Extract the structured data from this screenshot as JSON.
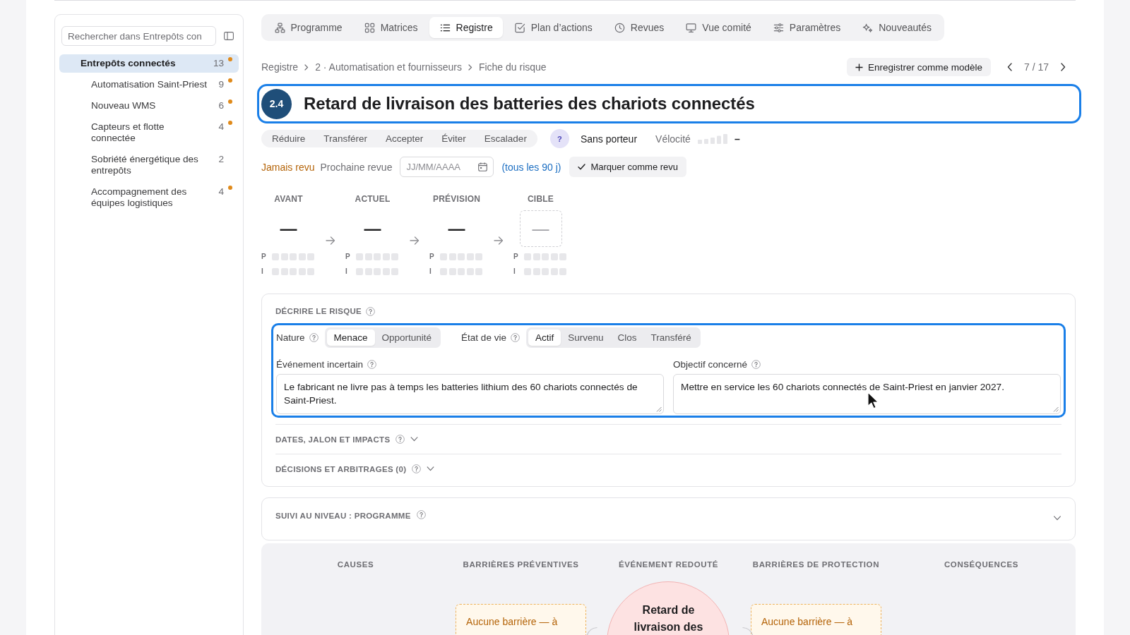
{
  "sidebar": {
    "search": {
      "placeholder": "Rechercher dans Entrepôts con"
    },
    "items": [
      {
        "label": "Entrepôts connectés",
        "count": "13",
        "flagged": true,
        "selected": true,
        "children": [
          {
            "label": "Automatisation Saint-Priest",
            "count": "9",
            "flagged": true,
            "selected": false
          },
          {
            "label": "Nouveau WMS",
            "count": "6",
            "flagged": true,
            "selected": false
          },
          {
            "label": "Capteurs et flotte connectée",
            "count": "4",
            "flagged": true,
            "selected": false
          },
          {
            "label": "Sobriété énergétique des entrepôts",
            "count": "2",
            "flagged": false,
            "selected": false
          },
          {
            "label": "Accompagnement des équipes logistiques",
            "count": "4",
            "flagged": true,
            "selected": false
          }
        ]
      }
    ]
  },
  "tabs": [
    {
      "label": "Programme",
      "selected": false
    },
    {
      "label": "Matrices",
      "selected": false
    },
    {
      "label": "Registre",
      "selected": true
    },
    {
      "label": "Plan d’actions",
      "selected": false
    },
    {
      "label": "Revues",
      "selected": false
    },
    {
      "label": "Vue comité",
      "selected": false
    },
    {
      "label": "Paramètres",
      "selected": false
    },
    {
      "label": "Nouveautés",
      "selected": false
    }
  ],
  "breadcrumb": [
    "Registre",
    "2 · Automatisation et fournisseurs",
    "Fiche du risque"
  ],
  "save_template_button": "Enregistrer comme modèle",
  "pager": "7 / 17",
  "risk": {
    "number": "2.4",
    "title": "Retard de livraison des batteries des chariots connectés",
    "focused": true
  },
  "responses": [
    {
      "label": "Réduire",
      "selected": false
    },
    {
      "label": "Transférer",
      "selected": false
    },
    {
      "label": "Accepter",
      "selected": false
    },
    {
      "label": "Éviter",
      "selected": false
    },
    {
      "label": "Escalader",
      "selected": false
    }
  ],
  "owner": {
    "avatar": "?",
    "name": "Sans porteur"
  },
  "velocity": {
    "label": "Vélocité",
    "value": "–"
  },
  "review": {
    "status": "Jamais revu",
    "next_label": "Prochaine revue",
    "date": {
      "placeholder": "JJ/MM/AAAA"
    },
    "frequency": "(tous les 90 j)",
    "mark_button": "Marquer comme revu"
  },
  "levels": [
    {
      "label": "AVANT",
      "kind": "score",
      "value": "—",
      "scales": [
        {
          "label": "P",
          "stars": 0
        },
        {
          "label": "I",
          "stars": 0
        }
      ]
    },
    {
      "label": "ACTUEL",
      "kind": "score",
      "value": "—",
      "scales": [
        {
          "label": "P",
          "stars": 0
        },
        {
          "label": "I",
          "stars": 0
        }
      ]
    },
    {
      "label": "PRÉVISION",
      "kind": "score",
      "value": "—",
      "scales": [
        {
          "label": "P",
          "stars": 0
        },
        {
          "label": "I",
          "stars": 0
        }
      ]
    },
    {
      "label": "CIBLE",
      "kind": "target",
      "value": "—",
      "scales": [
        {
          "label": "P",
          "stars": 0
        },
        {
          "label": "I",
          "stars": 0
        }
      ]
    }
  ],
  "describe": {
    "title": "DÉCRIRE LE RISQUE",
    "focused": true,
    "nature": {
      "label": "Nature",
      "options": [
        {
          "label": "Menace",
          "selected": true
        },
        {
          "label": "Opportunité",
          "selected": false
        }
      ]
    },
    "lifecycle": {
      "label": "État de vie",
      "options": [
        {
          "label": "Actif",
          "selected": true
        },
        {
          "label": "Survenu",
          "selected": false
        },
        {
          "label": "Clos",
          "selected": false
        },
        {
          "label": "Transféré",
          "selected": false
        }
      ]
    },
    "fields": [
      {
        "label": "Événement incertain",
        "value": "Le fabricant ne livre pas à temps les batteries lithium des 60 chariots connectés de Saint-Priest."
      },
      {
        "label": "Objectif concerné",
        "value": "Mettre en service les 60 chariots connectés de Saint-Priest en janvier 2027."
      }
    ],
    "sections": [
      {
        "title": "DATES, JALON ET IMPACTS",
        "expanded": false
      },
      {
        "title": "DÉCISIONS ET ARBITRAGES (0)",
        "expanded": false
      }
    ]
  },
  "tracking": {
    "title": "SUIVI AU NIVEAU : PROGRAMME",
    "expanded": false
  },
  "bowtie": {
    "columns": [
      {
        "title": "CAUSES"
      },
      {
        "title": "BARRIÈRES PRÉVENTIVES",
        "barrier": "Aucune barrière — à"
      },
      {
        "title": "ÉVÉNEMENT REDOUTÉ",
        "event": "Retard de livraison des"
      },
      {
        "title": "BARRIÈRES DE PROTECTION",
        "barrier": "Aucune barrière — à"
      },
      {
        "title": "CONSÉQUENCES"
      }
    ]
  }
}
